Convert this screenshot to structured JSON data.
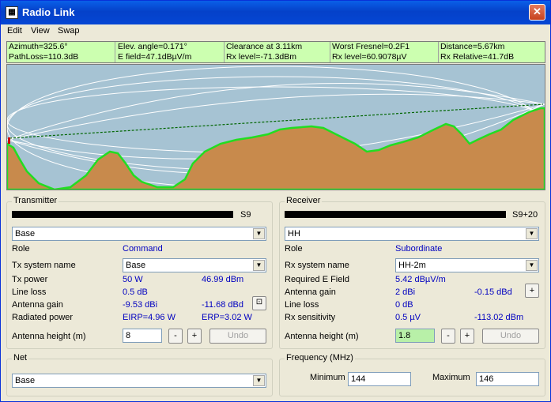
{
  "window": {
    "title": "Radio Link",
    "close_glyph": "✕"
  },
  "menu": {
    "items": [
      "Edit",
      "View",
      "Swap"
    ]
  },
  "info": {
    "row1": [
      "Azimuth=325.6°",
      "Elev. angle=0.171°",
      "Clearance at 3.11km",
      "Worst Fresnel=0.2F1",
      "Distance=5.67km"
    ],
    "row2": [
      "PathLoss=110.3dB",
      "E field=47.1dBµV/m",
      "Rx level=-71.3dBm",
      "Rx level=60.9078µV",
      "Rx Relative=41.7dB"
    ]
  },
  "colors": {
    "sky": "#a6c3d3",
    "terrain": "#c88a4c",
    "terrain_edge": "#22dd22",
    "los_line": "#006600",
    "meter_on": "#22dd22",
    "meter_high": "#a00000"
  },
  "transmitter": {
    "legend": "Transmitter",
    "meter_label": "S9",
    "meter_on": 8,
    "meter_total": 11,
    "unit": "Base",
    "role_label": "Role",
    "role_value": "Command",
    "system_label": "Tx system name",
    "system_value": "Base",
    "power_label": "Tx power",
    "power_w": "50 W",
    "power_dbm": "46.99 dBm",
    "lineloss_label": "Line loss",
    "lineloss_value": "0.5 dB",
    "gain_label": "Antenna gain",
    "gain_dbi": "-9.53 dBi",
    "gain_dbd": "-11.68 dBd",
    "radiated_label": "Radiated power",
    "eirp": "EIRP=4.96 W",
    "erp": "ERP=3.02 W",
    "height_label": "Antenna height (m)",
    "height_value": "8",
    "minus": "-",
    "plus": "+",
    "undo": "Undo"
  },
  "receiver": {
    "legend": "Receiver",
    "meter_label": "S9+20",
    "meter_on": 8,
    "meter_total": 11,
    "unit": "HH",
    "role_label": "Role",
    "role_value": "Subordinate",
    "system_label": "Rx system name",
    "system_value": "HH-2m",
    "field_label": "Required E Field",
    "field_value": "5.42 dBµV/m",
    "gain_label": "Antenna gain",
    "gain_dbi": "2 dBi",
    "gain_dbd": "-0.15 dBd",
    "lineloss_label": "Line loss",
    "lineloss_value": "0 dB",
    "sens_label": "Rx sensitivity",
    "sens_uv": "0.5 µV",
    "sens_dbm": "-113.02 dBm",
    "height_label": "Antenna height (m)",
    "height_value": "1.8",
    "minus": "-",
    "plus": "+",
    "undo": "Undo"
  },
  "net": {
    "legend": "Net",
    "value": "Base"
  },
  "frequency": {
    "legend": "Frequency (MHz)",
    "min_label": "Minimum",
    "min_value": "144",
    "max_label": "Maximum",
    "max_value": "146"
  }
}
